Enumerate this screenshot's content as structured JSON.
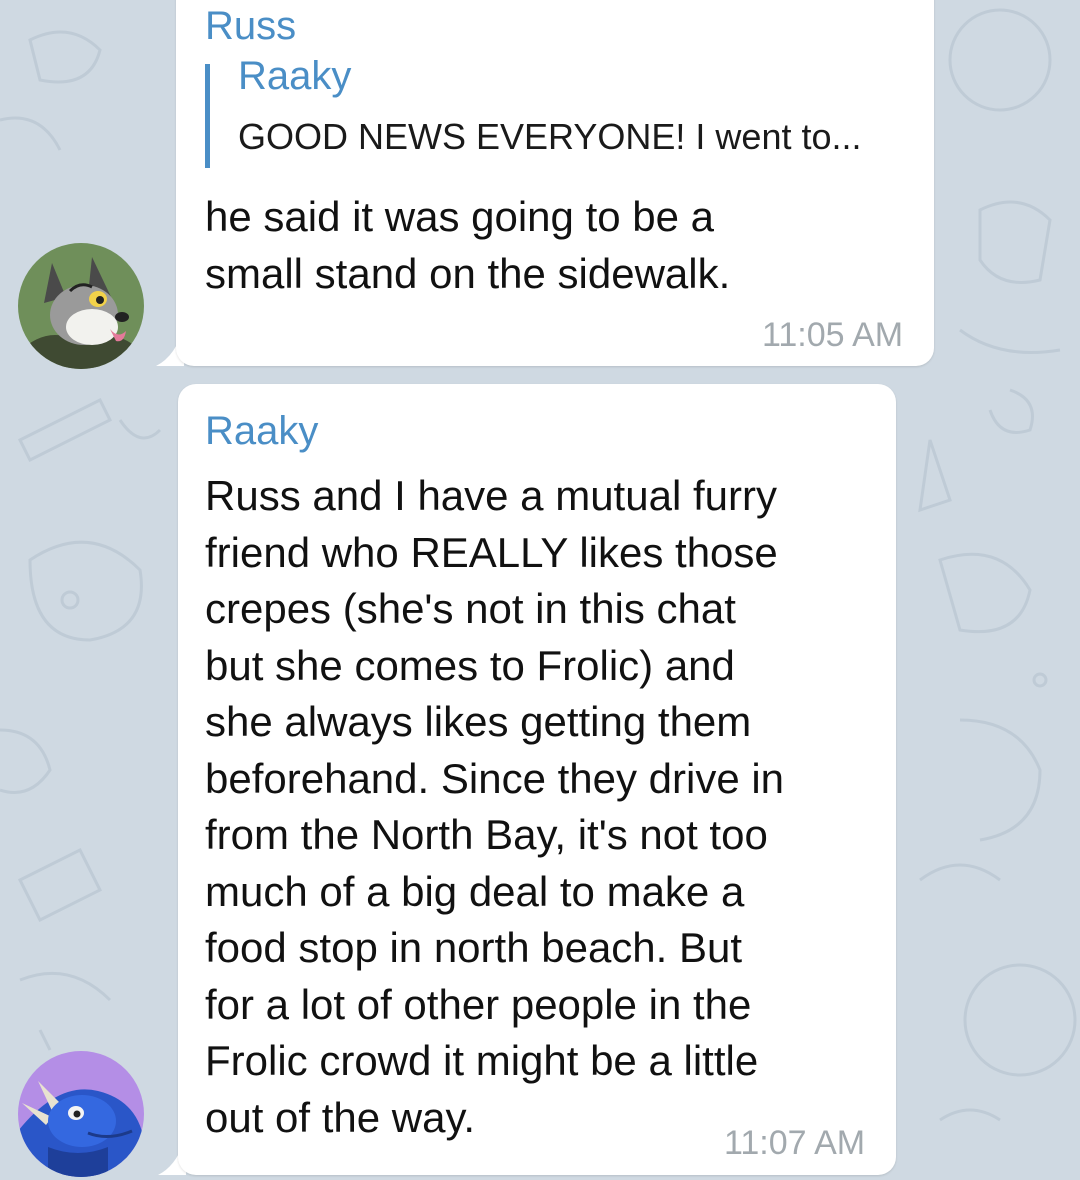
{
  "messages": [
    {
      "sender": "Russ",
      "reply": {
        "name": "Raaky",
        "text": "GOOD NEWS EVERYONE! I went to..."
      },
      "lines": [
        "he said it was going to be a",
        "small stand on the sidewalk."
      ],
      "time": "11:05 AM",
      "avatar": "fox-avatar"
    },
    {
      "sender": "Raaky",
      "lines": [
        "Russ and I have a mutual furry",
        "friend who REALLY likes those",
        "crepes (she's not in this chat",
        "but she comes to Frolic) and",
        "she always likes getting them",
        "beforehand. Since they drive in",
        "from the North Bay, it's not too",
        "much of a big deal to make a",
        "food stop in north beach. But",
        "for a lot of other people in the",
        "Frolic crowd it might be a little",
        "out of the way."
      ],
      "time": "11:07 AM",
      "avatar": "dragon-avatar"
    }
  ],
  "colors": {
    "background": "#cfd9e2",
    "bubble": "#ffffff",
    "accent": "#4a8ec6",
    "time": "#a2a9ae"
  }
}
